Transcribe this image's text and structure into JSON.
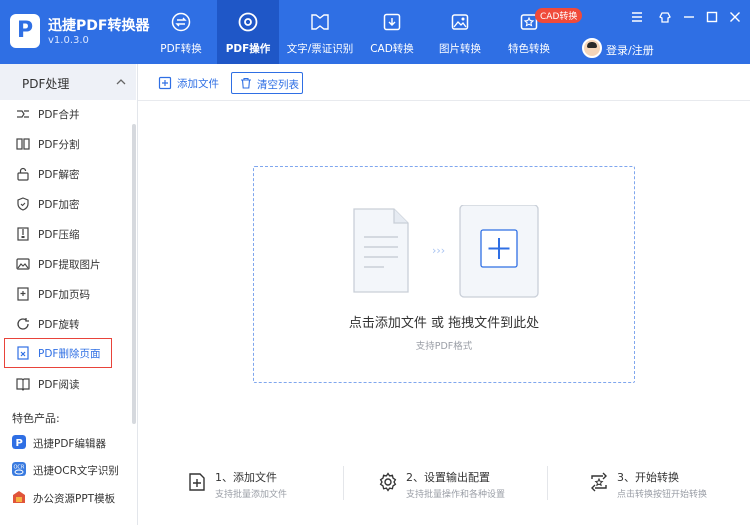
{
  "app": {
    "name": "迅捷PDF转换器",
    "version": "v1.0.3.0"
  },
  "nav": {
    "tabs": [
      {
        "label": "PDF转换",
        "icon": "swap-icon"
      },
      {
        "label": "PDF操作",
        "icon": "compass-icon",
        "active": true
      },
      {
        "label": "文字/票证识别",
        "icon": "scan-icon"
      },
      {
        "label": "CAD转换",
        "icon": "download-box-icon"
      },
      {
        "label": "图片转换",
        "icon": "image-icon"
      },
      {
        "label": "特色转换",
        "icon": "star-box-icon"
      }
    ],
    "badge": "CAD转换",
    "login_label": "登录/注册"
  },
  "sidebar": {
    "section_title": "PDF处理",
    "items": [
      {
        "label": "PDF合并",
        "icon": "merge-icon"
      },
      {
        "label": "PDF分割",
        "icon": "split-icon"
      },
      {
        "label": "PDF解密",
        "icon": "unlock-icon"
      },
      {
        "label": "PDF加密",
        "icon": "shield-icon"
      },
      {
        "label": "PDF压缩",
        "icon": "compress-icon"
      },
      {
        "label": "PDF提取图片",
        "icon": "image-extract-icon"
      },
      {
        "label": "PDF加页码",
        "icon": "page-number-icon"
      },
      {
        "label": "PDF旋转",
        "icon": "rotate-icon"
      },
      {
        "label": "PDF删除页面",
        "icon": "delete-page-icon",
        "selected": true
      },
      {
        "label": "PDF阅读",
        "icon": "book-icon"
      }
    ],
    "featured_title": "特色产品:",
    "featured": [
      {
        "label": "迅捷PDF编辑器",
        "icon": "pdf-editor-icon",
        "color": "#2f6fe4"
      },
      {
        "label": "迅捷OCR文字识别",
        "icon": "ocr-icon",
        "color": "#3a7be0"
      },
      {
        "label": "办公资源PPT模板",
        "icon": "ppt-icon",
        "color": "#e0543a"
      }
    ]
  },
  "toolbar": {
    "add_label": "添加文件",
    "clear_label": "清空列表"
  },
  "dropzone": {
    "main_text": "点击添加文件 或 拖拽文件到此处",
    "sub_text": "支持PDF格式"
  },
  "steps": [
    {
      "title": "1、添加文件",
      "desc": "支持批量添加文件",
      "icon": "add-file-icon"
    },
    {
      "title": "2、设置输出配置",
      "desc": "支持批量操作和各种设置",
      "icon": "settings-gear-icon"
    },
    {
      "title": "3、开始转换",
      "desc": "点击转换按钮开始转换",
      "icon": "convert-icon"
    }
  ],
  "colors": {
    "brand": "#2f6fe4",
    "active_tab": "#1f57c7",
    "badge": "#f04a3a",
    "selected_border": "#e8433a"
  }
}
